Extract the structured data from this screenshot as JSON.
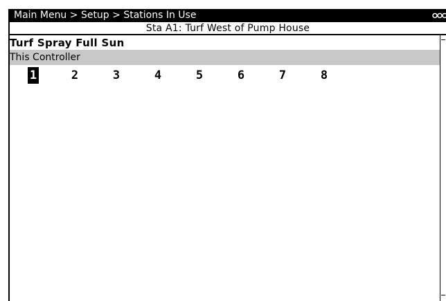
{
  "breadcrumb": {
    "text": "Main Menu > Setup > Stations In Use"
  },
  "header": {
    "station_title": "Sta A1: Turf West of Pump House"
  },
  "program": {
    "name": "Turf Spray Full Sun"
  },
  "controller": {
    "label": "This Controller"
  },
  "stations": [
    {
      "label": "1",
      "selected": true
    },
    {
      "label": "2",
      "selected": false
    },
    {
      "label": "3",
      "selected": false
    },
    {
      "label": "4",
      "selected": false
    },
    {
      "label": "5",
      "selected": false
    },
    {
      "label": "6",
      "selected": false
    },
    {
      "label": "7",
      "selected": false
    },
    {
      "label": "8",
      "selected": false
    }
  ],
  "icons": {
    "menu": "more-icon"
  }
}
